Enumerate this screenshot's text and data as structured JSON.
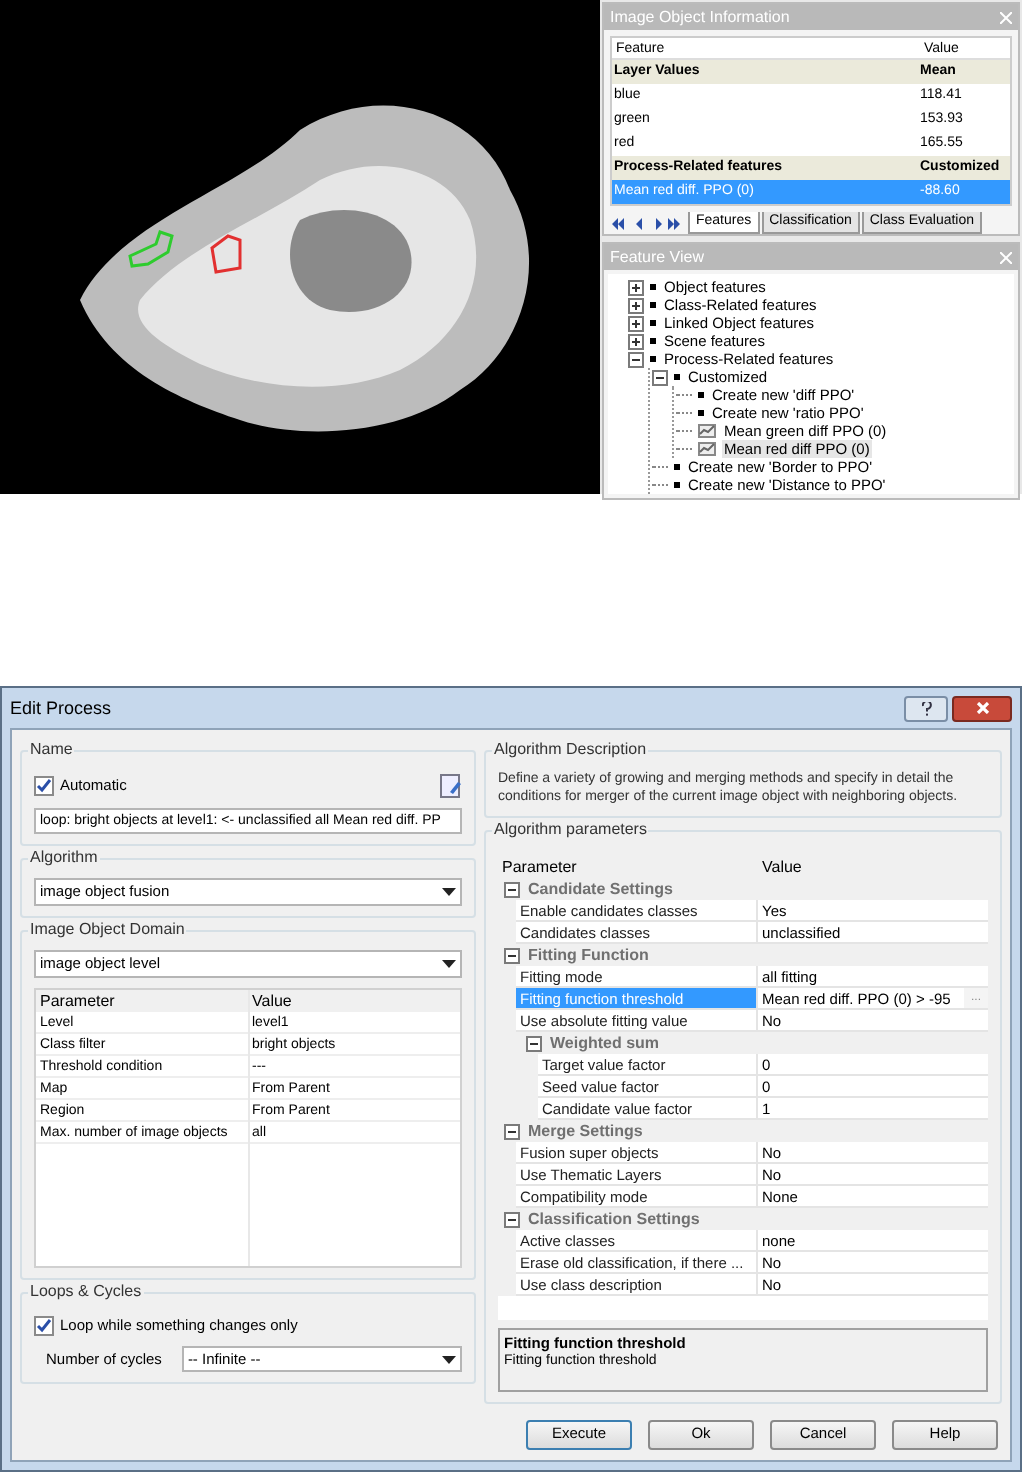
{
  "object_info": {
    "title": "Image Object Information",
    "columns": [
      "Feature",
      "Value"
    ],
    "rows": [
      {
        "kind": "group",
        "feature": "Layer Values",
        "value": "Mean",
        "selected": false
      },
      {
        "kind": "row",
        "feature": "blue",
        "value": "118.41",
        "selected": false
      },
      {
        "kind": "row",
        "feature": "green",
        "value": "153.93",
        "selected": false
      },
      {
        "kind": "row",
        "feature": "red",
        "value": "165.55",
        "selected": false
      },
      {
        "kind": "group",
        "feature": "Process-Related features",
        "value": "Customized",
        "selected": false
      },
      {
        "kind": "row",
        "feature": "Mean red diff. PPO (0)",
        "value": "-88.60",
        "selected": true
      }
    ],
    "tabs": [
      {
        "label": "Features",
        "selected": true
      },
      {
        "label": "Classification",
        "selected": false
      },
      {
        "label": "Class Evaluation",
        "selected": false
      }
    ]
  },
  "feature_view": {
    "title": "Feature View",
    "tree": [
      {
        "kind": "folder",
        "label": "Object features",
        "expanded": false
      },
      {
        "kind": "folder",
        "label": "Class-Related features",
        "expanded": false
      },
      {
        "kind": "folder",
        "label": "Linked Object features",
        "expanded": false
      },
      {
        "kind": "folder",
        "label": "Scene features",
        "expanded": false
      },
      {
        "kind": "folder",
        "label": "Process-Related features",
        "expanded": true,
        "children": [
          {
            "kind": "folder",
            "label": "Customized",
            "expanded": true,
            "children": [
              {
                "kind": "item",
                "label": "Create new 'diff PPO'",
                "selected": false
              },
              {
                "kind": "item",
                "label": "Create new 'ratio PPO'",
                "selected": false
              },
              {
                "kind": "feature",
                "label": "Mean green diff PPO (0)",
                "selected": false
              },
              {
                "kind": "feature",
                "label": "Mean red diff PPO (0)",
                "selected": true
              }
            ]
          },
          {
            "kind": "item",
            "label": "Create new 'Border to PPO'",
            "selected": false
          },
          {
            "kind": "item",
            "label": "Create new 'Distance to PPO'",
            "selected": false
          }
        ]
      }
    ]
  },
  "edit_process": {
    "title": "Edit Process",
    "name": {
      "label": "Name",
      "automatic": {
        "label": "Automatic",
        "checked": true
      },
      "value": "loop: bright objects at  level1: <- unclassified all Mean red diff. PP"
    },
    "algorithm": {
      "label": "Algorithm",
      "value": "image object fusion"
    },
    "domain": {
      "label": "Image Object Domain",
      "value": "image object level",
      "columns": [
        "Parameter",
        "Value"
      ],
      "rows": [
        {
          "name": "Level",
          "value": "level1"
        },
        {
          "name": "Class filter",
          "value": "bright objects"
        },
        {
          "name": "Threshold condition",
          "value": "---"
        },
        {
          "name": "Map",
          "value": "From Parent"
        },
        {
          "name": "Region",
          "value": "From Parent"
        },
        {
          "name": "Max. number of image objects",
          "value": "all"
        }
      ]
    },
    "loops": {
      "label": "Loops & Cycles",
      "loop_only_changes": {
        "label": "Loop while something changes only",
        "checked": true
      },
      "cycles": {
        "label": "Number of cycles",
        "value": "-- Infinite --"
      }
    },
    "description": {
      "label": "Algorithm Description",
      "text": "Define a variety of growing and merging methods and specify in detail the conditions for merger of the current image object with neighboring objects."
    },
    "parameters": {
      "label": "Algorithm parameters",
      "columns": [
        "Parameter",
        "Value"
      ],
      "rows": [
        {
          "kind": "group",
          "name": "Candidate Settings",
          "expanded": true,
          "children": [
            {
              "kind": "row",
              "name": "Enable candidates classes",
              "value": "Yes",
              "selected": false
            },
            {
              "kind": "row",
              "name": "Candidates classes",
              "value": "unclassified",
              "selected": false
            }
          ]
        },
        {
          "kind": "group",
          "name": "Fitting Function",
          "expanded": true,
          "children": [
            {
              "kind": "row",
              "name": "Fitting mode",
              "value": "all fitting",
              "selected": false
            },
            {
              "kind": "row",
              "name": "Fitting function threshold",
              "value": "Mean red diff. PPO (0) > -95",
              "selected": true,
              "browse": "..."
            },
            {
              "kind": "row",
              "name": "Use absolute fitting value",
              "value": "No",
              "selected": false
            },
            {
              "kind": "group",
              "name": "Weighted sum",
              "expanded": true,
              "children": [
                {
                  "kind": "row",
                  "name": "Target value factor",
                  "value": "0",
                  "selected": false
                },
                {
                  "kind": "row",
                  "name": "Seed value factor",
                  "value": "0",
                  "selected": false
                },
                {
                  "kind": "row",
                  "name": "Candidate value factor",
                  "value": "1",
                  "selected": false
                }
              ]
            }
          ]
        },
        {
          "kind": "group",
          "name": "Merge Settings",
          "expanded": true,
          "children": [
            {
              "kind": "row",
              "name": "Fusion super objects",
              "value": "No",
              "selected": false
            },
            {
              "kind": "row",
              "name": "Use Thematic Layers",
              "value": "No",
              "selected": false
            },
            {
              "kind": "row",
              "name": "Compatibility mode",
              "value": "None",
              "selected": false
            }
          ]
        },
        {
          "kind": "group",
          "name": "Classification Settings",
          "expanded": true,
          "children": [
            {
              "kind": "row",
              "name": "Active classes",
              "value": "none",
              "selected": false
            },
            {
              "kind": "row",
              "name": "Erase old classification, if there ...",
              "value": "No",
              "selected": false
            },
            {
              "kind": "row",
              "name": "Use class description",
              "value": "No",
              "selected": false
            }
          ]
        }
      ]
    },
    "help": {
      "title": "Fitting function threshold",
      "text": "Fitting function threshold"
    },
    "buttons": [
      "Execute",
      "Ok",
      "Cancel",
      "Help"
    ]
  }
}
